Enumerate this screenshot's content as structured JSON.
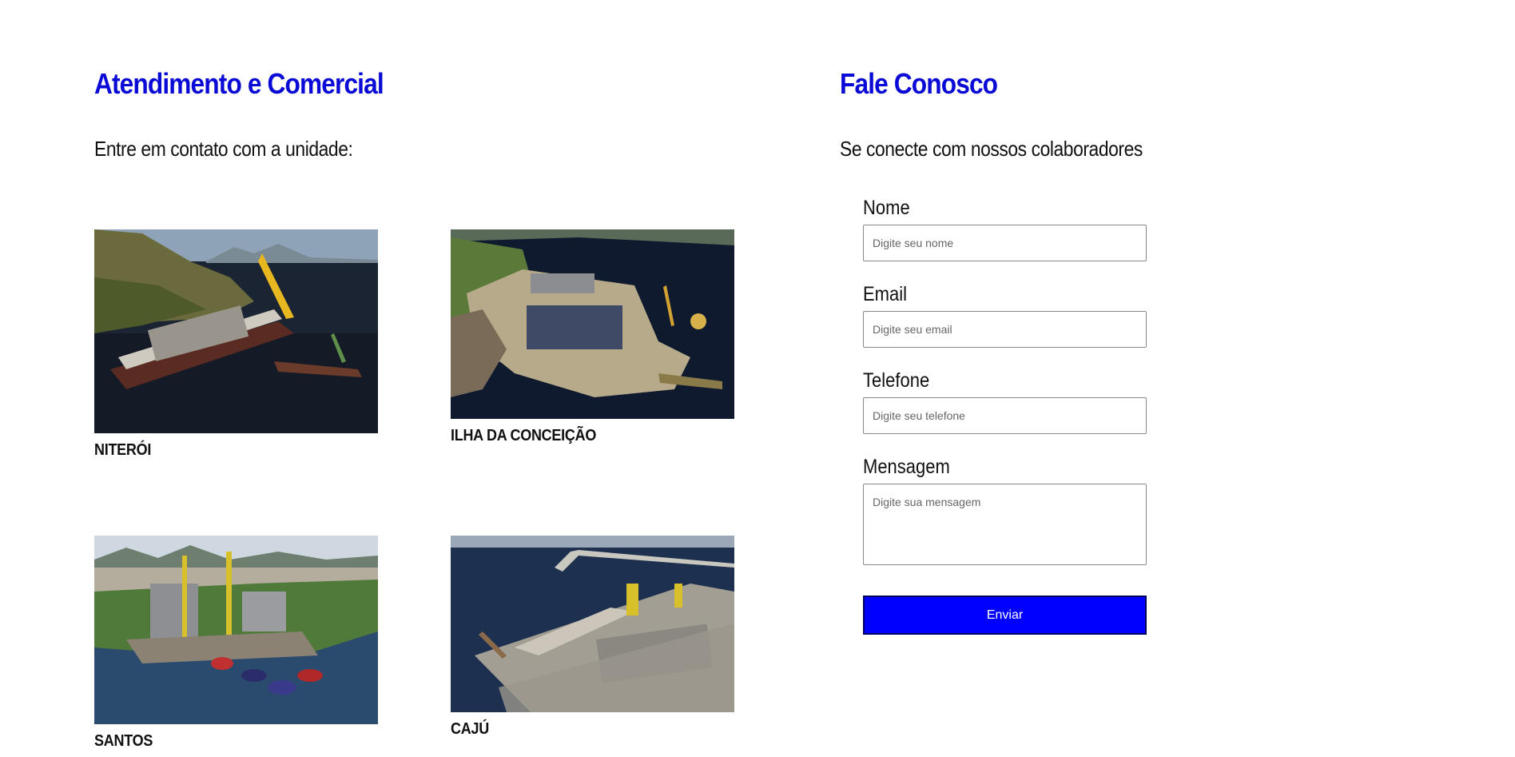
{
  "left": {
    "title": "Atendimento e Comercial",
    "subtitle": "Entre em contato com a unidade:",
    "units": [
      {
        "name": "NITERÓI"
      },
      {
        "name": "ILHA DA CONCEIÇÃO"
      },
      {
        "name": "SANTOS"
      },
      {
        "name": "CAJÚ"
      }
    ]
  },
  "right": {
    "title": "Fale Conosco",
    "subtitle": "Se conecte com nossos colaboradores",
    "form": {
      "name_label": "Nome",
      "name_placeholder": "Digite seu nome",
      "email_label": "Email",
      "email_placeholder": "Digite seu email",
      "phone_label": "Telefone",
      "phone_placeholder": "Digite seu telefone",
      "message_label": "Mensagem",
      "message_placeholder": "Digite sua mensagem",
      "submit_label": "Enviar"
    }
  },
  "colors": {
    "heading": "#0a0ad6",
    "button": "#0000ff"
  }
}
